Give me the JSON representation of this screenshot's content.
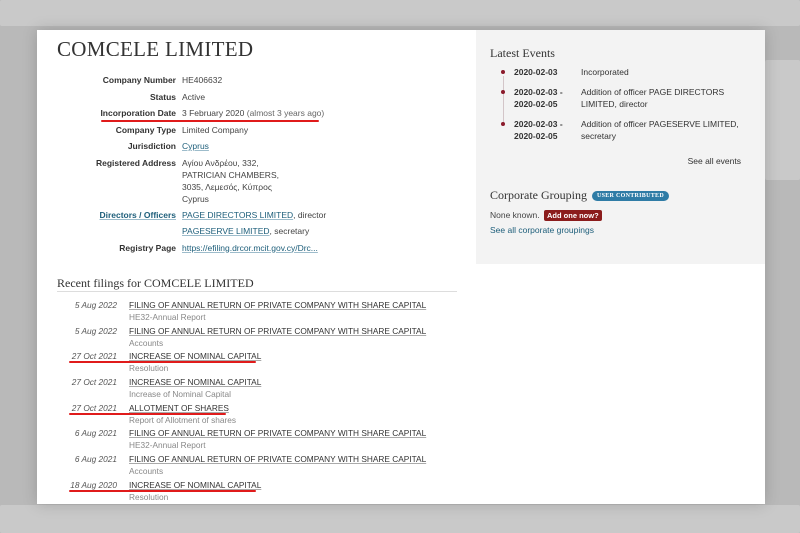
{
  "company": {
    "name": "COMCELE LIMITED",
    "details": [
      {
        "label": "Company Number",
        "value": "HE406632"
      },
      {
        "label": "Status",
        "value": "Active"
      },
      {
        "label": "Incorporation Date",
        "value": "3 February 2020",
        "extra": "(almost 3 years ago)"
      },
      {
        "label": "Company Type",
        "value": "Limited Company"
      },
      {
        "label": "Jurisdiction",
        "value": "Cyprus"
      },
      {
        "label": "Registered Address",
        "lines": [
          "Αγίου Ανδρέου, 332,",
          "PATRICIAN CHAMBERS,",
          "3035, Λεμεσός, Κύπρος",
          "Cyprus"
        ]
      },
      {
        "label": "Directors / Officers",
        "officers": [
          {
            "name": "PAGE DIRECTORS LIMITED",
            "role": ", director"
          },
          {
            "name": "PAGESERVE LIMITED",
            "role": ", secretary"
          }
        ]
      },
      {
        "label": "Registry Page",
        "value": "https://efiling.drcor.mcit.gov.cy/Drc..."
      }
    ]
  },
  "sidebar": {
    "latest_events_title": "Latest Events",
    "events": [
      {
        "date": "2020-02-03",
        "text": "Incorporated"
      },
      {
        "date": "2020-02-03 - 2020-02-05",
        "text": "Addition of officer PAGE DIRECTORS LIMITED, director"
      },
      {
        "date": "2020-02-03 - 2020-02-05",
        "text": "Addition of officer PAGESERVE LIMITED, secretary"
      }
    ],
    "see_all_events": "See all events",
    "corporate_grouping_title": "Corporate Grouping",
    "user_contributed_badge": "USER CONTRIBUTED",
    "none_known": "None known.",
    "add_one": "Add one now?",
    "see_all_groupings": "See all corporate groupings"
  },
  "filings": {
    "title": "Recent filings for COMCELE LIMITED",
    "rows": [
      {
        "date": "5 Aug 2022",
        "desc": "FILING OF ANNUAL RETURN OF PRIVATE COMPANY WITH SHARE CAPITAL",
        "sub": "HE32-Annual Report"
      },
      {
        "date": "5 Aug 2022",
        "desc": "FILING OF ANNUAL RETURN OF PRIVATE COMPANY WITH SHARE CAPITAL",
        "sub": "Accounts"
      },
      {
        "date": "27 Oct 2021",
        "desc": "INCREASE OF NOMINAL CAPITAL",
        "sub": "Resolution"
      },
      {
        "date": "27 Oct 2021",
        "desc": "INCREASE OF NOMINAL CAPITAL",
        "sub": "Increase of Nominal Capital"
      },
      {
        "date": "27 Oct 2021",
        "desc": "ALLOTMENT OF SHARES",
        "sub": "Report of Allotment of shares"
      },
      {
        "date": "6 Aug 2021",
        "desc": "FILING OF ANNUAL RETURN OF PRIVATE COMPANY WITH SHARE CAPITAL",
        "sub": "HE32-Annual Report"
      },
      {
        "date": "6 Aug 2021",
        "desc": "FILING OF ANNUAL RETURN OF PRIVATE COMPANY WITH SHARE CAPITAL",
        "sub": "Accounts"
      },
      {
        "date": "18 Aug 2020",
        "desc": "INCREASE OF NOMINAL CAPITAL",
        "sub": "Resolution"
      }
    ]
  },
  "colors": {
    "link": "#1d5e7a",
    "highlight_underline": "#e01b1b",
    "badge": "#2f7ca6",
    "add_button": "#8b1c1c",
    "event_dot": "#8b1a2b"
  }
}
